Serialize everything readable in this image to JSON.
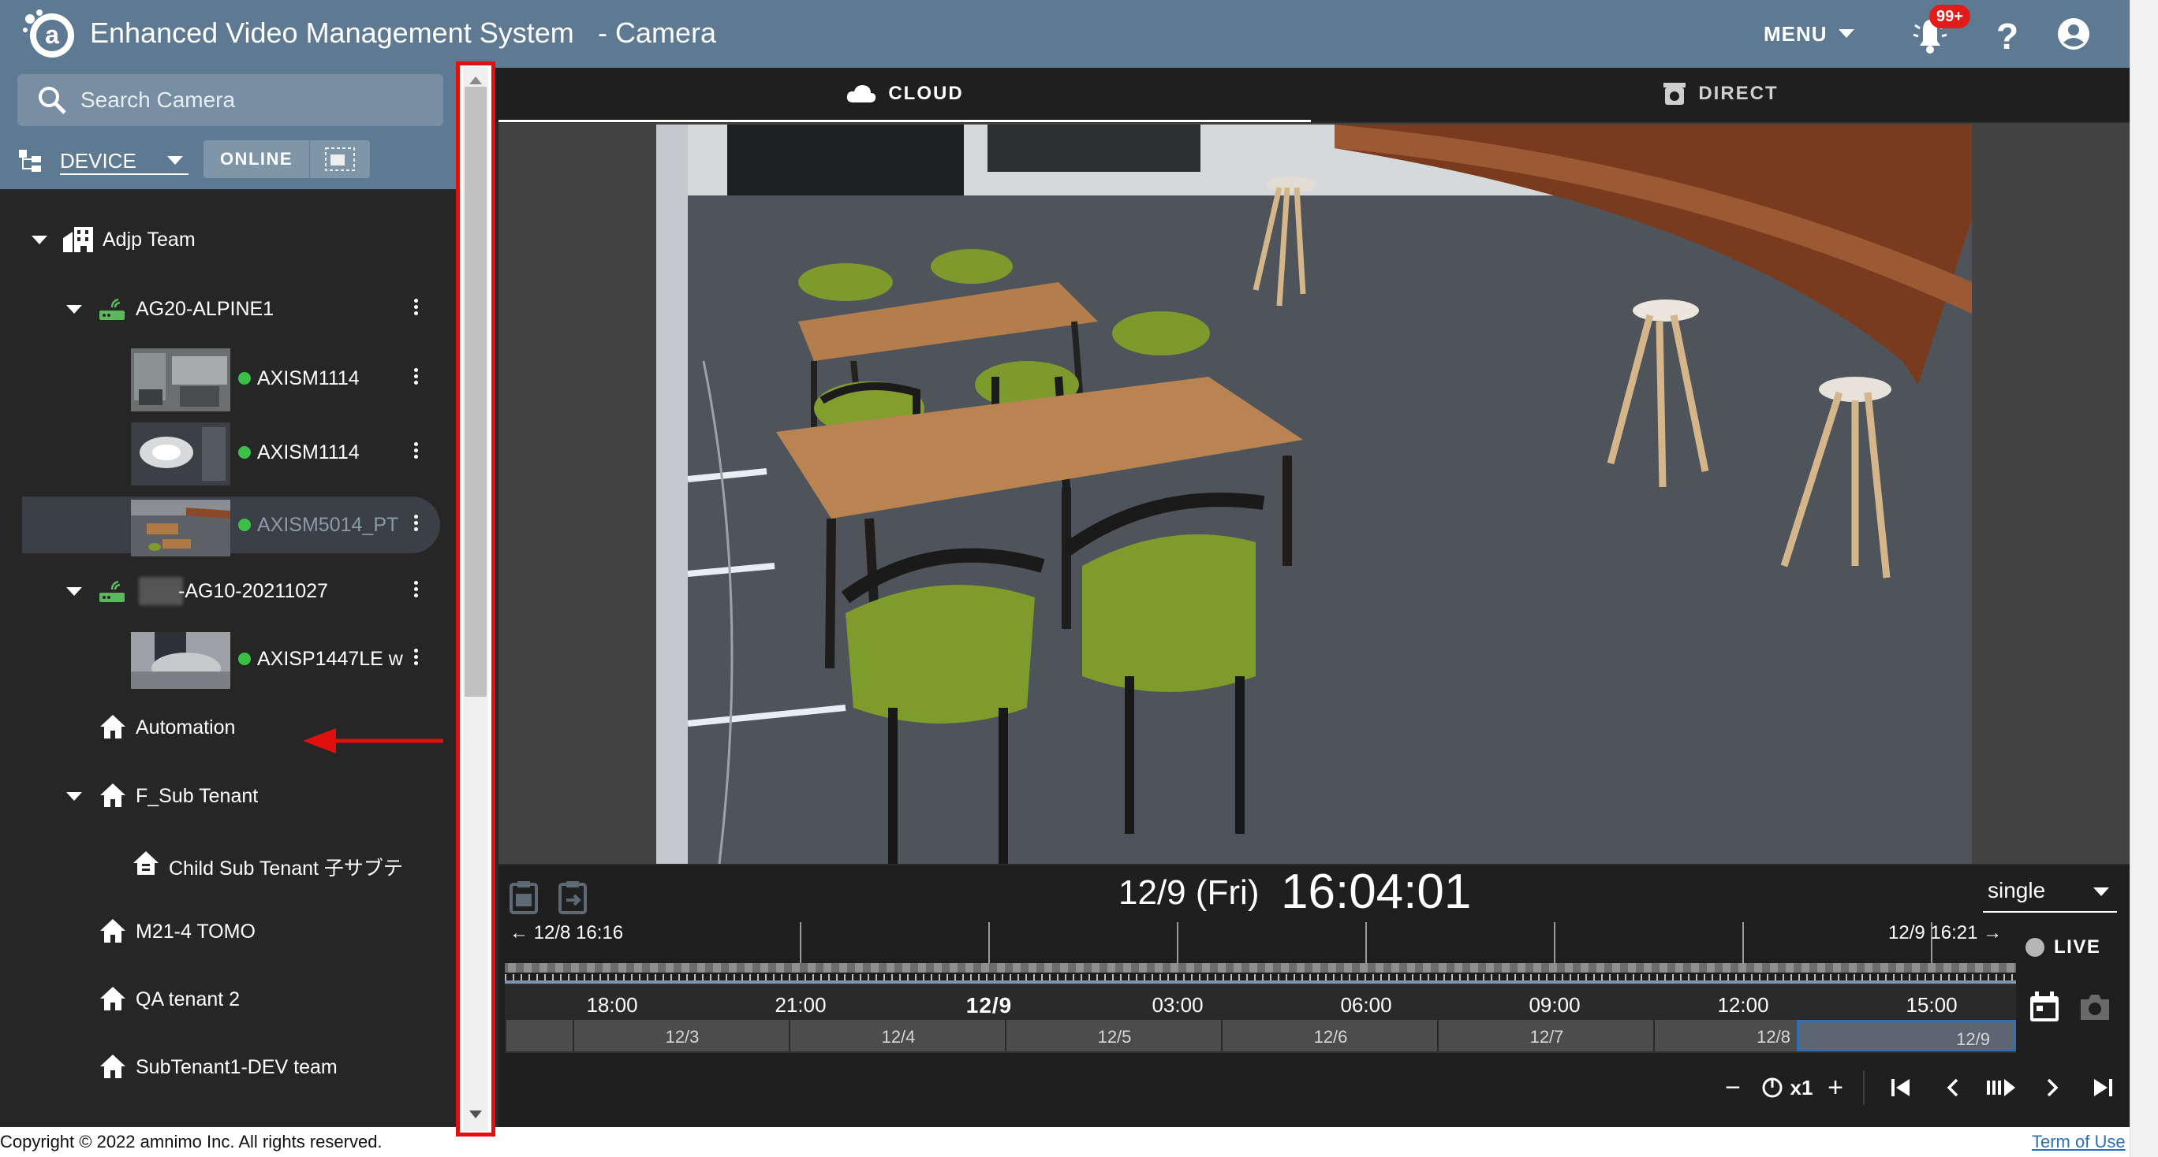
{
  "header": {
    "app_title": "Enhanced Video Management System",
    "page_name": "- Camera",
    "menu_label": "MENU",
    "notification_badge": "99+"
  },
  "sidebar": {
    "search_placeholder": "Search Camera",
    "device_select": "DEVICE",
    "online_label": "ONLINE",
    "tree": [
      {
        "label": "Adjp Team",
        "type": "tenant"
      },
      {
        "label": "AG20-ALPINE1",
        "type": "gateway"
      },
      {
        "label": "AXISM1114",
        "type": "camera",
        "status": "online"
      },
      {
        "label": "AXISM1114",
        "type": "camera",
        "status": "online"
      },
      {
        "label": "AXISM5014_PT",
        "type": "camera",
        "status": "online",
        "selected": true
      },
      {
        "label": "-AG10-20211027",
        "type": "gateway"
      },
      {
        "label": "AXISP1447LE w",
        "type": "camera",
        "status": "online"
      },
      {
        "label": "Automation",
        "type": "tenant"
      },
      {
        "label": "F_Sub Tenant",
        "type": "tenant"
      },
      {
        "label": "Child Sub Tenant 子サブテ",
        "type": "subtenant"
      },
      {
        "label": "M21-4 TOMO",
        "type": "tenant"
      },
      {
        "label": "QA tenant 2",
        "type": "tenant"
      },
      {
        "label": "SubTenant1-DEV team",
        "type": "tenant"
      }
    ],
    "copyright": "Copyright © 2022 amnimo Inc. All rights reserved."
  },
  "tabs": {
    "cloud": "CLOUD",
    "direct": "DIRECT"
  },
  "player": {
    "date": "12/9 (Fri)",
    "time": "16:04:01",
    "mode": "single",
    "live_label": "LIVE",
    "speed": "x1"
  },
  "timeline": {
    "range_start": "← 12/8 16:16",
    "range_end": "12/9 16:21 →",
    "hours": [
      "18:00",
      "21:00",
      "12/9",
      "03:00",
      "06:00",
      "09:00",
      "12:00",
      "15:00"
    ],
    "days": [
      "12/3",
      "12/4",
      "12/5",
      "12/6",
      "12/7",
      "12/8",
      "12/9"
    ]
  },
  "footer": {
    "term_link": "Term of Use"
  },
  "colors": {
    "header": "#5e7a92",
    "sidebar": "#262626",
    "annotation_red": "#e0100f",
    "online_dot": "#3cbf47",
    "badge": "#e21b1b"
  },
  "icons": [
    "logo-icon",
    "bell-icon",
    "help-icon",
    "account-icon",
    "search-icon",
    "tree-icon",
    "map-icon",
    "building-icon",
    "router-icon",
    "home-icon",
    "cloud-icon",
    "camera-icon",
    "clipboard-icon",
    "calendar-icon",
    "snapshot-icon"
  ]
}
